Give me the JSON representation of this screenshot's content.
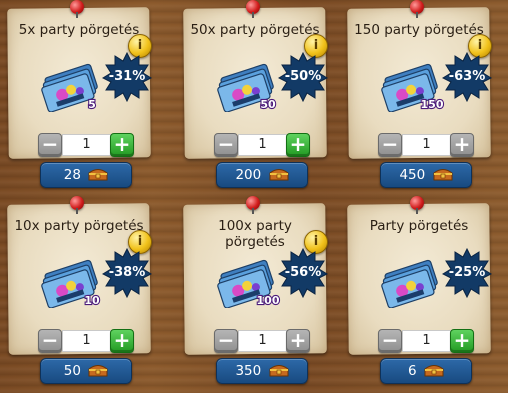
{
  "colors": {
    "plus_active": "#229a22",
    "disabled": "#8f8f8f",
    "price_button": "#184a80",
    "badge": "#123a66",
    "info": "#f1c21b"
  },
  "icons": {
    "info": "i",
    "minus": "−",
    "plus": "+",
    "price_icon": "treasure-chest-icon"
  },
  "cards": [
    {
      "title": "5x party pörgetés",
      "discount": "-31%",
      "ticket_count": "5",
      "quantity": "1",
      "plus_enabled": true,
      "price": "28",
      "has_info": true
    },
    {
      "title": "50x party pörgetés",
      "discount": "-50%",
      "ticket_count": "50",
      "quantity": "1",
      "plus_enabled": true,
      "price": "200",
      "has_info": true
    },
    {
      "title": "150 party pörgetés",
      "discount": "-63%",
      "ticket_count": "150",
      "quantity": "1",
      "plus_enabled": false,
      "price": "450",
      "has_info": true
    },
    {
      "title": "10x party pörgetés",
      "discount": "-38%",
      "ticket_count": "10",
      "quantity": "1",
      "plus_enabled": true,
      "price": "50",
      "has_info": true
    },
    {
      "title": "100x party pörgetés",
      "discount": "-56%",
      "ticket_count": "100",
      "quantity": "1",
      "plus_enabled": false,
      "price": "350",
      "has_info": true
    },
    {
      "title": "Party pörgetés",
      "discount": "-25%",
      "ticket_count": "",
      "quantity": "1",
      "plus_enabled": true,
      "price": "6",
      "has_info": false
    }
  ]
}
